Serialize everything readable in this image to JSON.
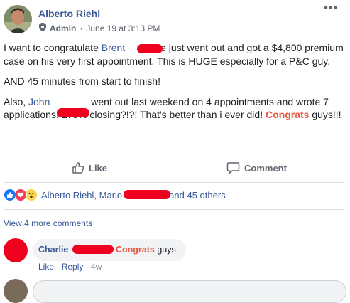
{
  "header": {
    "author": "Alberto Riehl",
    "role": "Admin",
    "separator": "·",
    "date": "June 19 at 3:13 PM",
    "more": "•••"
  },
  "post": {
    "p1_before": "I want to congratulate ",
    "p1_mention": "Brent",
    "p1_after": "! He just went out and got a $4,800 premium case on his very first appointment. This is HUGE especially for a P&C guy.",
    "p2": "AND 45 minutes from start to finish!",
    "p3_before": "Also, ",
    "p3_mention": "John",
    "p3_after": " went out last weekend on 4 appointments and wrote 7 applications! 175% closing?!?! That's better than i ever did! ",
    "p3_highlight": "Congrats",
    "p3_end": " guys!!!"
  },
  "actions": {
    "like": "Like",
    "comment": "Comment"
  },
  "reactions": {
    "names_start": "Alberto Riehl, Mario",
    "names_end": "and 45 others",
    "icons": [
      "like-icon",
      "love-icon",
      "wow-icon"
    ],
    "colors": {
      "like": "#1877f2",
      "love": "#f33e58",
      "wow": "#fcd64a"
    }
  },
  "comments": {
    "view_more": "View 4 more comments",
    "items": [
      {
        "author": "Charlie",
        "highlight": "Congrats",
        "text": " guys",
        "like": "Like",
        "reply": "Reply",
        "sep": " · ",
        "time": "4w"
      }
    ]
  },
  "colors": {
    "link": "#385898",
    "highlight": "#e9573f",
    "muted": "#606770",
    "redaction": "#f0001f"
  }
}
